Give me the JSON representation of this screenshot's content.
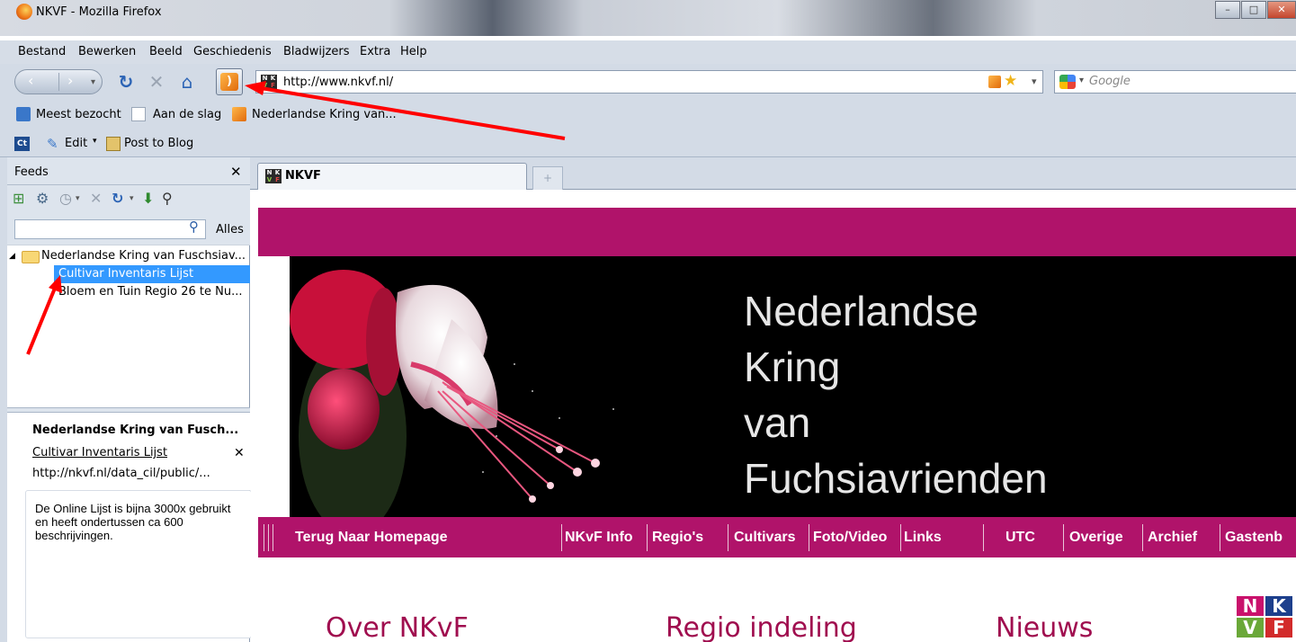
{
  "window": {
    "title": "NKVF - Mozilla Firefox"
  },
  "menu": [
    "Bestand",
    "Bewerken",
    "Beeld",
    "Geschiedenis",
    "Bladwijzers",
    "Extra",
    "Help"
  ],
  "url": "http://www.nkvf.nl/",
  "search_placeholder": "Google",
  "bookmarks": [
    "Meest bezocht",
    "Aan de slag",
    "Nederlandse Kring van..."
  ],
  "addon_bar": {
    "edit": "Edit",
    "post": "Post to Blog"
  },
  "sidebar": {
    "title": "Feeds",
    "filter_label": "Alles",
    "tree": {
      "folder": "Nederlandse Kring van Fuschsiav...",
      "items": [
        "Cultivar Inventaris Lijst",
        "Bloem en Tuin Regio 26 te Nu..."
      ],
      "selected_index": 0
    },
    "detail": {
      "title": "Nederlandse Kring van Fusch...",
      "link": "Cultivar Inventaris Lijst",
      "url": "http://nkvf.nl/data_cil/public/..."
    },
    "description": "De Online Lijst is bijna 3000x gebruikt en heeft ondertussen ca 600 beschrijvingen."
  },
  "tab": {
    "label": "NKVF"
  },
  "site": {
    "banner_lines": [
      "Nederlandse",
      "Kring",
      "van",
      "Fuchsiavrienden"
    ],
    "nav": [
      "Terug Naar Homepage",
      "NKvF Info",
      "Regio's",
      "Cultivars",
      "Foto/Video",
      "Links",
      "UTC",
      "Overige",
      "Archief",
      "Gastenb"
    ],
    "sections": [
      "Over NKvF",
      "Regio indeling",
      "Nieuws"
    ],
    "logo_letters": [
      "N",
      "K",
      "V",
      "F"
    ]
  },
  "colors": {
    "site_accent": "#b0136a",
    "selection": "#3399ff",
    "annotation_arrow": "#ff0000"
  }
}
